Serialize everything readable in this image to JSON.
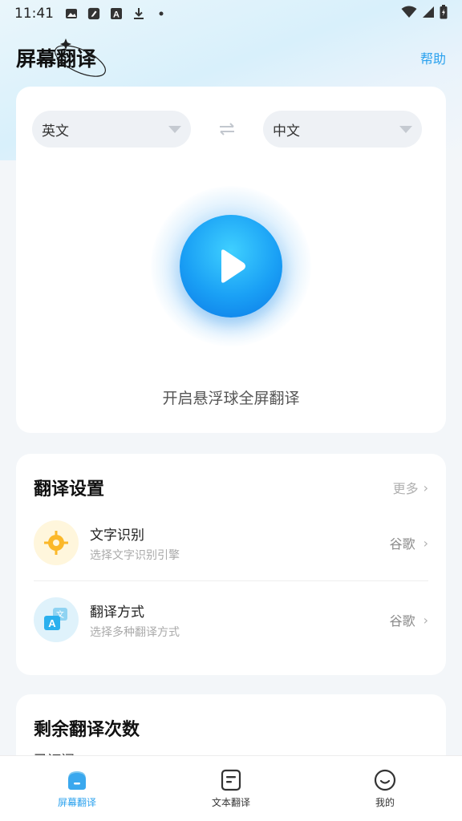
{
  "status_bar": {
    "time": "11:41"
  },
  "header": {
    "title": "屏幕翻译",
    "help_label": "帮助"
  },
  "languages": {
    "source": "英文",
    "target": "中文"
  },
  "main": {
    "caption": "开启悬浮球全屏翻译"
  },
  "settings": {
    "title": "翻译设置",
    "more_label": "更多",
    "items": [
      {
        "title": "文字识别",
        "subtitle": "选择文字识别引擎",
        "value": "谷歌",
        "icon": "ocr-target-icon"
      },
      {
        "title": "翻译方式",
        "subtitle": "选择多种翻译方式",
        "value": "谷歌",
        "icon": "translate-method-icon"
      }
    ]
  },
  "remaining": {
    "title": "剩余翻译次数",
    "subtitle": "已订阅"
  },
  "nav": {
    "items": [
      {
        "label": "屏幕翻译",
        "active": true
      },
      {
        "label": "文本翻译",
        "active": false
      },
      {
        "label": "我的",
        "active": false
      }
    ]
  },
  "colors": {
    "accent": "#2aa1ee",
    "play_gradient_start": "#3fd0ff",
    "play_gradient_end": "#0b78e6"
  }
}
